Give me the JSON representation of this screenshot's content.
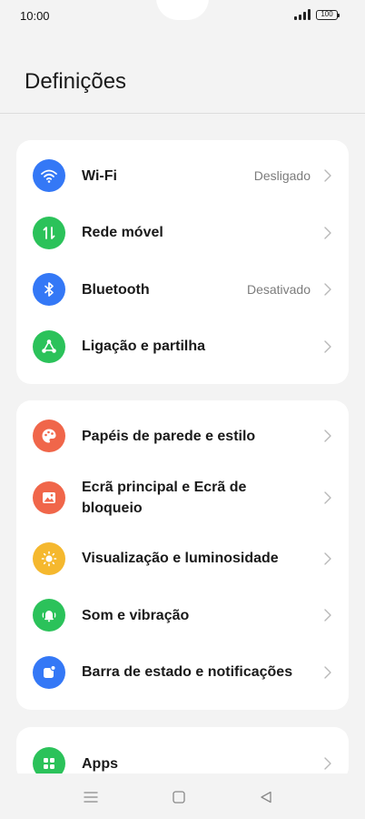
{
  "status_bar": {
    "time": "10:00",
    "battery": "100"
  },
  "header": {
    "title": "Definições"
  },
  "groups": [
    {
      "items": [
        {
          "label": "Wi-Fi",
          "value": "Desligado",
          "icon": "wifi-icon",
          "color": "#3478f6"
        },
        {
          "label": "Rede móvel",
          "value": "",
          "icon": "mobile-data-icon",
          "color": "#2bc25a"
        },
        {
          "label": "Bluetooth",
          "value": "Desativado",
          "icon": "bluetooth-icon",
          "color": "#3478f6"
        },
        {
          "label": "Ligação e partilha",
          "value": "",
          "icon": "connection-share-icon",
          "color": "#2bc25a"
        }
      ]
    },
    {
      "items": [
        {
          "label": "Papéis de parede e estilo",
          "value": "",
          "icon": "palette-icon",
          "color": "#f0664a"
        },
        {
          "label": "Ecrã principal e Ecrã de bloqueio",
          "value": "",
          "icon": "image-icon",
          "color": "#f0664a"
        },
        {
          "label": "Visualização e luminosidade",
          "value": "",
          "icon": "brightness-icon",
          "color": "#f5b82e"
        },
        {
          "label": "Som e vibração",
          "value": "",
          "icon": "bell-icon",
          "color": "#2bc25a"
        },
        {
          "label": "Barra de estado e notificações",
          "value": "",
          "icon": "notification-icon",
          "color": "#3478f6"
        }
      ]
    },
    {
      "items": [
        {
          "label": "Apps",
          "value": "",
          "icon": "apps-icon",
          "color": "#2bc25a"
        }
      ]
    }
  ],
  "nav_bar": {
    "menu_icon": "menu-icon",
    "home_icon": "home-icon",
    "back_icon": "back-icon"
  }
}
